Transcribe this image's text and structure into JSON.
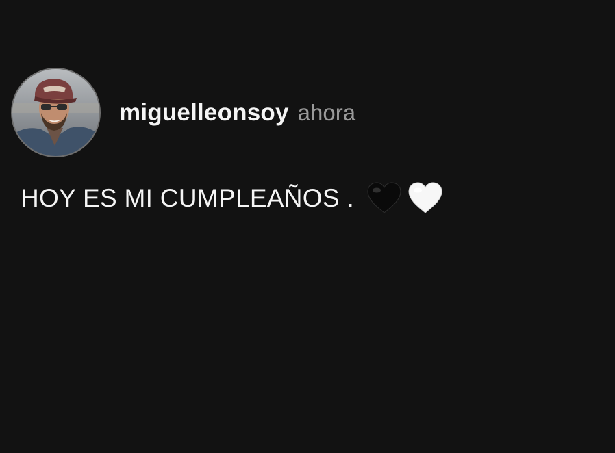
{
  "post": {
    "author": {
      "username": "miguelleonsoy",
      "avatar_alt": "profile photo"
    },
    "timestamp": "ahora",
    "caption": "HOY ES MI CUMPLEAÑOS .",
    "emojis": [
      "black-heart-icon",
      "white-heart-icon"
    ]
  },
  "colors": {
    "background": "#121212",
    "text": "#f5f5f5",
    "timestamp": "#9a9a9a",
    "black_heart": "#0a0a0a",
    "white_heart": "#f7f7f7"
  }
}
